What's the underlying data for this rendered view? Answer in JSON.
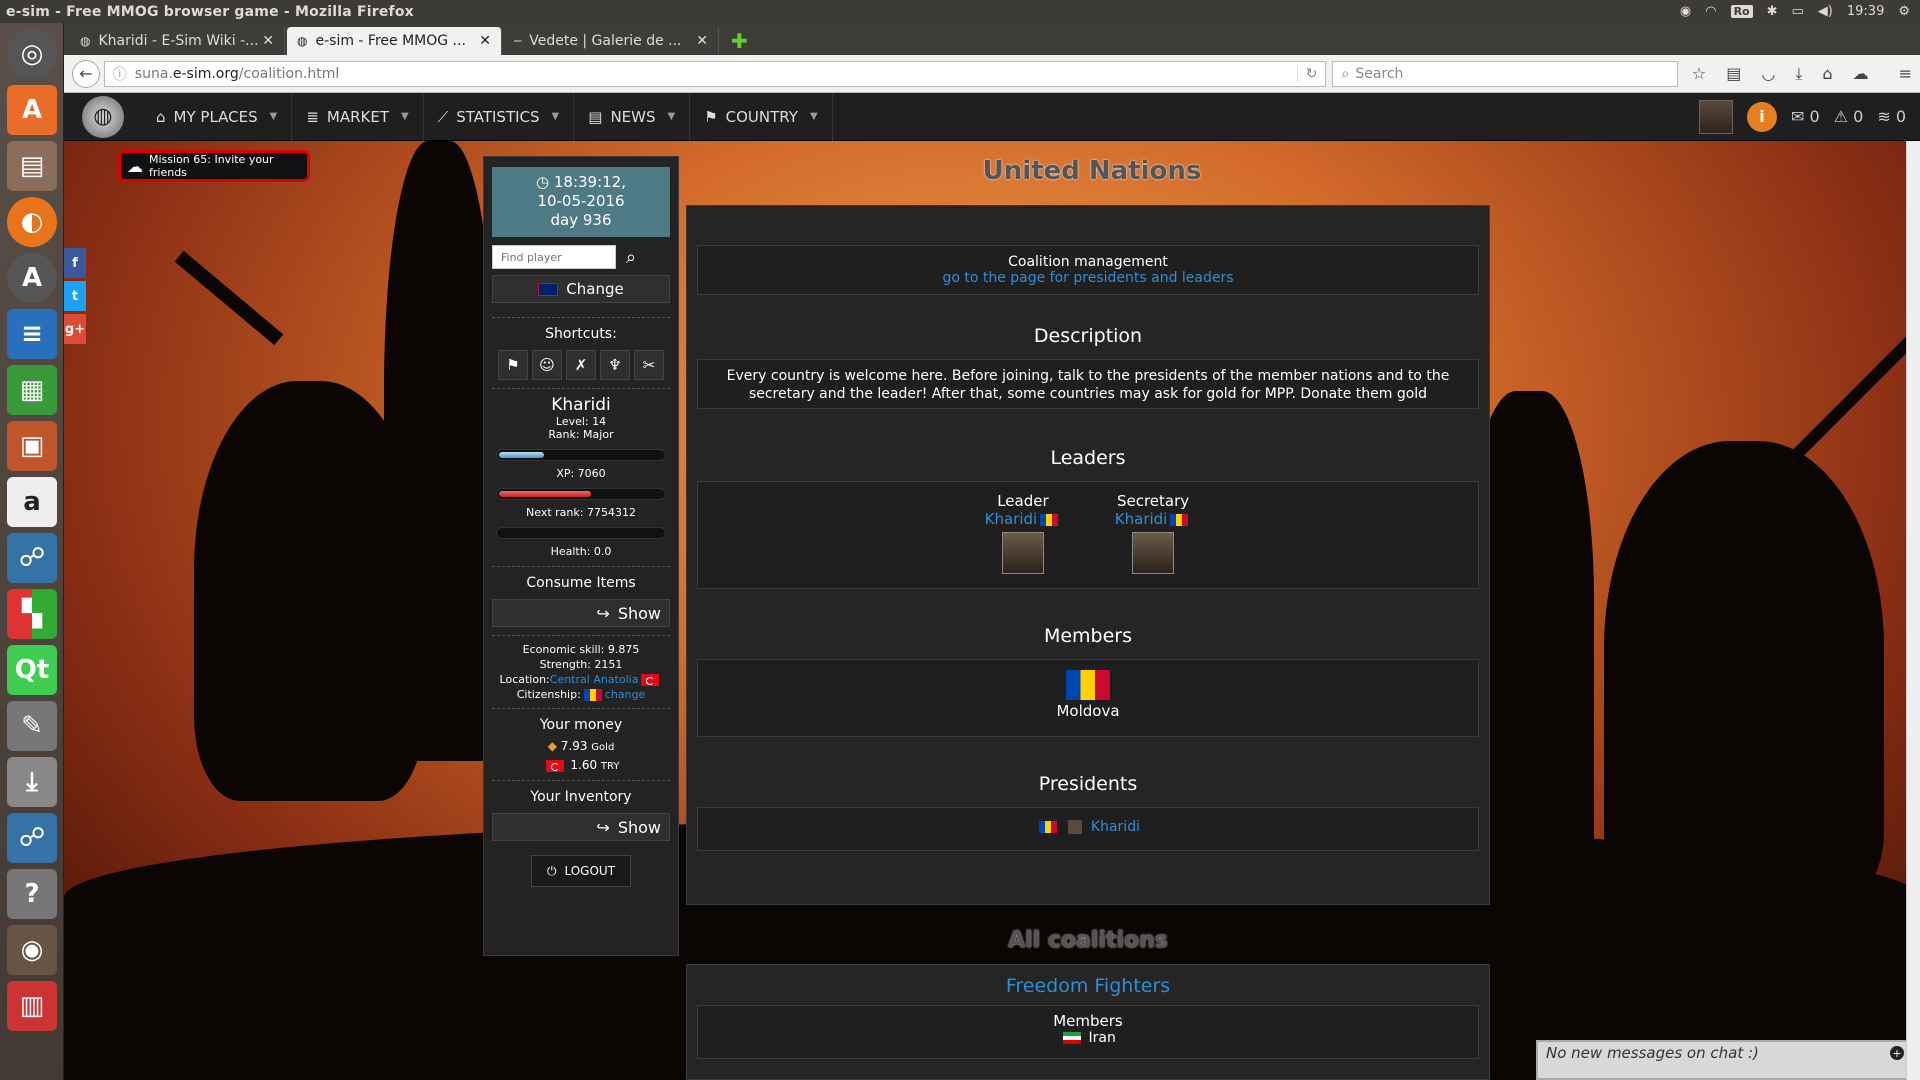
{
  "window": {
    "title": "e-sim - Free MMOG browser game - Mozilla Firefox",
    "clock": "19:39",
    "keyboard": "Ro"
  },
  "tabs": [
    {
      "label": "Kharidi - E-Sim Wiki -..."
    },
    {
      "label": "e-sim - Free MMOG ..."
    },
    {
      "label": "Vedete | Galerie de ..."
    }
  ],
  "address": {
    "prefix": "suna.",
    "host": "e-sim.org",
    "path": "/coalition.html",
    "search_placeholder": "Search"
  },
  "nav": {
    "items": [
      "MY PLACES",
      "MARKET",
      "STATISTICS",
      "NEWS",
      "COUNTRY"
    ],
    "counts": {
      "messages": "0",
      "alerts": "0",
      "feed": "0"
    }
  },
  "mission": "Mission 65: Invite your friends",
  "side": {
    "time": "18:39:12,",
    "date": "10-05-2016",
    "day": "day 936",
    "find_placeholder": "Find player",
    "change": "Change",
    "shortcuts_label": "Shortcuts:",
    "player": "Kharidi",
    "level": "Level: 14",
    "rank": "Rank: Major",
    "xp": "XP:  7060",
    "next_rank": "Next rank:  7754312",
    "health": "Health:  0.0",
    "consume_label": "Consume Items",
    "show": "Show",
    "economic": "Economic skill: 9.875",
    "strength": "Strength: 2151",
    "location_label": "Location:",
    "location": "Central Anatolia",
    "citizenship_label": "Citizenship:",
    "citizenship_change": "change",
    "money_label": "Your money",
    "gold": "7.93",
    "gold_unit": "Gold",
    "try": "1.60",
    "try_unit": "TRY",
    "inventory_label": "Your Inventory",
    "logout": "LOGOUT",
    "xp_progress": 0.27,
    "rank_progress": 0.55,
    "health_progress": 0.0
  },
  "main": {
    "title": "United Nations",
    "mgmt_title": "Coalition management",
    "mgmt_link": "go to the page for presidents and leaders",
    "desc_title": "Description",
    "description": "Every country is welcome here. Before joining, talk to the presidents of the member nations and to the secretary and the leader! After that, some countries may ask for gold for MPP. Donate them gold",
    "leaders_title": "Leaders",
    "leader_label": "Leader",
    "leader_name": "Kharidi",
    "secretary_label": "Secretary",
    "secretary_name": "Kharidi",
    "members_title": "Members",
    "member": "Moldova",
    "presidents_title": "Presidents",
    "president": "Kharidi"
  },
  "all": {
    "title": "All coalitions",
    "co1": "Freedom Fighters",
    "members_label": "Members",
    "co1_member": "Iran"
  },
  "chat": "No new messages on chat :)"
}
